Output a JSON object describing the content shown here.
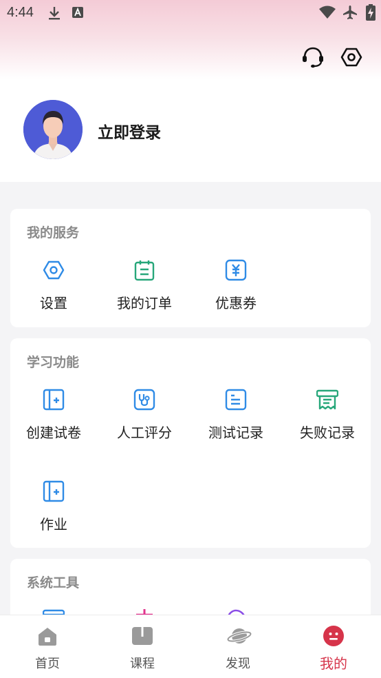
{
  "status_bar": {
    "time": "4:44",
    "left_icons": [
      "download-icon",
      "app-a-icon"
    ],
    "right_icons": [
      "wifi-icon",
      "airplane-mode-icon",
      "battery-charging-icon"
    ]
  },
  "header": {
    "icons": [
      "customer-service-headset-icon",
      "settings-hexagon-icon"
    ]
  },
  "profile": {
    "login_label": "立即登录"
  },
  "colors": {
    "accent_blue": "#2f8be6",
    "accent_green": "#27a77a",
    "active_red": "#d6344a",
    "title_gray": "#8a8a8a"
  },
  "services": {
    "title": "我的服务",
    "items": [
      {
        "label": "设置",
        "icon": "settings-hexagon-icon"
      },
      {
        "label": "我的订单",
        "icon": "order-notepad-icon"
      },
      {
        "label": "优惠券",
        "icon": "coupon-yen-icon"
      }
    ]
  },
  "learning": {
    "title": "学习功能",
    "items": [
      {
        "label": "创建试卷",
        "icon": "create-paper-icon"
      },
      {
        "label": "人工评分",
        "icon": "stethoscope-icon"
      },
      {
        "label": "测试记录",
        "icon": "test-record-icon"
      },
      {
        "label": "失败记录",
        "icon": "failure-record-icon"
      },
      {
        "label": "作业",
        "icon": "homework-icon"
      }
    ]
  },
  "tools": {
    "title": "系统工具"
  },
  "tabbar": {
    "tabs": [
      {
        "label": "首页",
        "icon": "home-icon"
      },
      {
        "label": "课程",
        "icon": "course-book-icon"
      },
      {
        "label": "发现",
        "icon": "discover-planet-icon"
      },
      {
        "label": "我的",
        "icon": "profile-face-icon",
        "active": true
      }
    ]
  }
}
